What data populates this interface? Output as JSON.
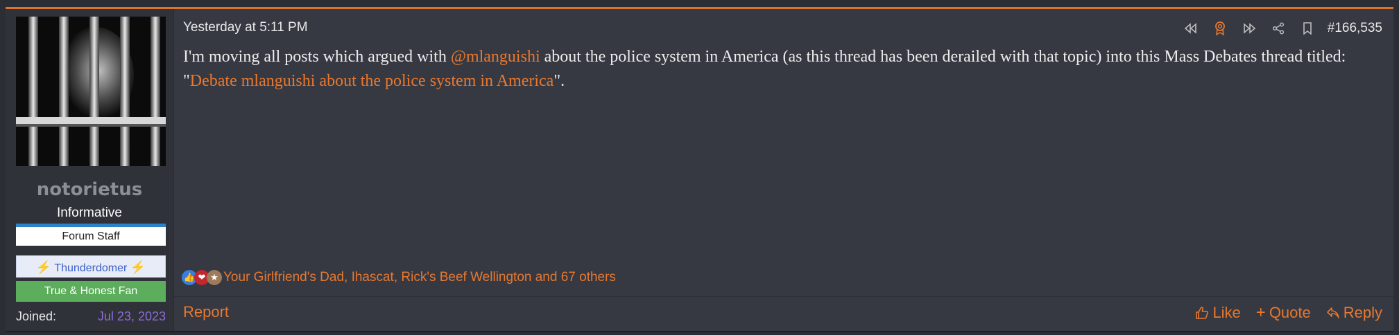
{
  "user": {
    "username": "notorietus",
    "title": "Informative",
    "banners": {
      "staff": "Forum Staff",
      "thunder": "Thunderdomer",
      "fan": "True & Honest Fan"
    },
    "joined_label": "Joined:",
    "joined_date": "Jul 23, 2023"
  },
  "post": {
    "timestamp": "Yesterday at 5:11 PM",
    "number": "#166,535",
    "message": {
      "part1": "I'm moving all posts which argued with ",
      "mention": "@mlanguishi",
      "part2": " about the police system in America (as this thread has been derailed with that topic) into this Mass Debates thread titled: \"",
      "link": "Debate mlanguishi about the police system in America",
      "part3": "\"."
    },
    "reactions_text": "Your Girlfriend's Dad, Ihascat, Rick's Beef Wellington and 67 others"
  },
  "footer": {
    "report": "Report",
    "like": "Like",
    "quote": "Quote",
    "reply": "Reply"
  },
  "colors": {
    "accent": "#e8782f",
    "background": "#363942",
    "sidebar": "#2f3239"
  },
  "icons": [
    "rewind-icon",
    "award-icon",
    "fast-forward-icon",
    "share-icon",
    "bookmark-icon",
    "like-icon",
    "quote-icon",
    "reply-icon"
  ]
}
